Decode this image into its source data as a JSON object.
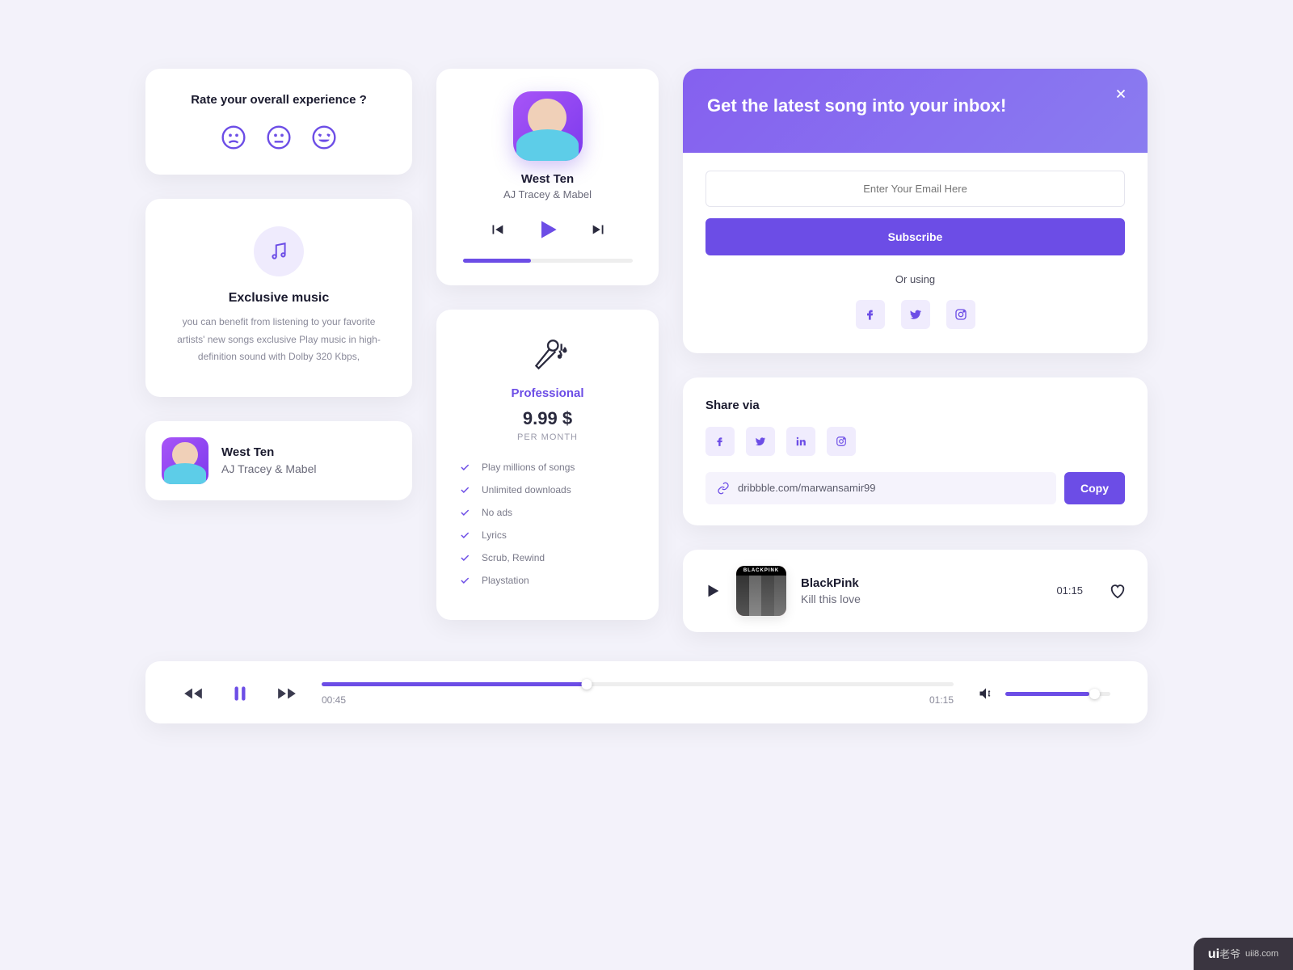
{
  "rating": {
    "title": "Rate your overall experience ?"
  },
  "exclusive": {
    "title": "Exclusive music",
    "desc": "you can benefit from listening to your favorite artists' new songs exclusive Play music in high-definition sound with Dolby 320 Kbps,"
  },
  "miniTrack": {
    "title": "West Ten",
    "artist": "AJ Tracey & Mabel"
  },
  "player": {
    "title": "West Ten",
    "artist": "AJ Tracey & Mabel"
  },
  "pricing": {
    "plan": "Professional",
    "price": "9.99 $",
    "per": "PER MONTH",
    "features": [
      "Play millions of songs",
      "Unlimited downloads",
      "No ads",
      "Lyrics",
      "Scrub, Rewind",
      "Playstation"
    ]
  },
  "subscribe": {
    "heading": "Get the latest song into your inbox!",
    "placeholder": "Enter Your Email Here",
    "button": "Subscribe",
    "or": "Or using"
  },
  "share": {
    "title": "Share via",
    "link": "dribbble.com/marwansamir99",
    "copy": "Copy"
  },
  "track": {
    "title": "BlackPink",
    "song": "Kill this love",
    "artLabel": "BLACKPINK",
    "duration": "01:15"
  },
  "bar": {
    "elapsed": "00:45",
    "total": "01:15"
  },
  "watermark": {
    "brand": "ui",
    "suffix": "老爷",
    "site": "uii8.com"
  }
}
